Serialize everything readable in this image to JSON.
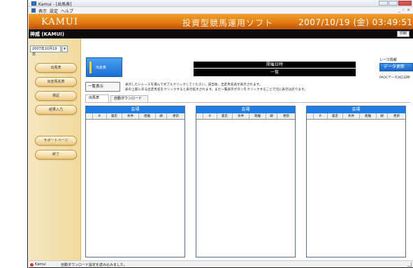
{
  "window": {
    "title": "Kamui - [出馬表]"
  },
  "menubar": {
    "items": [
      "表示",
      "設定",
      "ヘルプ"
    ],
    "mdi_controls": "_ ♢ ×"
  },
  "banner": {
    "logo": "KAMUI",
    "app_title": "投資型競馬運用ソフト",
    "datetime": "2007/10/19 (金) 03:49:51"
  },
  "course": {
    "label": "神威 (KAMUI)",
    "print_label": "印刷"
  },
  "sidebar": {
    "date_value": "2007年10月19日",
    "buttons": [
      "出馬表",
      "出走馬名表",
      "検証",
      "結果入力",
      "サポートページ",
      "終了"
    ]
  },
  "main": {
    "race_button_label": "出走表",
    "header_top": "開催日時",
    "header_sub": "一覧",
    "list_button_label": "一覧表示",
    "instruction_1": "表示したいレースを選んでダブルクリックしてください。該当後、出走馬名表が表示されます。",
    "instruction_2": "表の上部にある出走馬名をクリックすると表示拡大されます。また一覧表示ボタンをクリックすることで元に表示は戻ります。",
    "tabs": [
      "出馬表",
      "自動ダウンロード"
    ]
  },
  "race_panel": {
    "title": "レース情報",
    "update_button": "データ更新",
    "data_date": "PAOCデータ対応日時"
  },
  "grids": [
    {
      "venue": "会場",
      "columns": [
        "R",
        "発走",
        "条件",
        "距離",
        "頭",
        "更新"
      ]
    },
    {
      "venue": "会場",
      "columns": [
        "R",
        "発走",
        "条件",
        "距離",
        "頭",
        "更新"
      ]
    },
    {
      "venue": "会場",
      "columns": [
        "R",
        "発走",
        "条件",
        "距離",
        "頭",
        "更新"
      ]
    }
  ],
  "status": {
    "app_name": "Kamui",
    "message": "自動ダウンロード設定を読み込みました。"
  },
  "colors": {
    "banner_orange": "#e37a10",
    "race_blue": "#1e7ee8",
    "sidebar_tan": "#f1d99c"
  }
}
